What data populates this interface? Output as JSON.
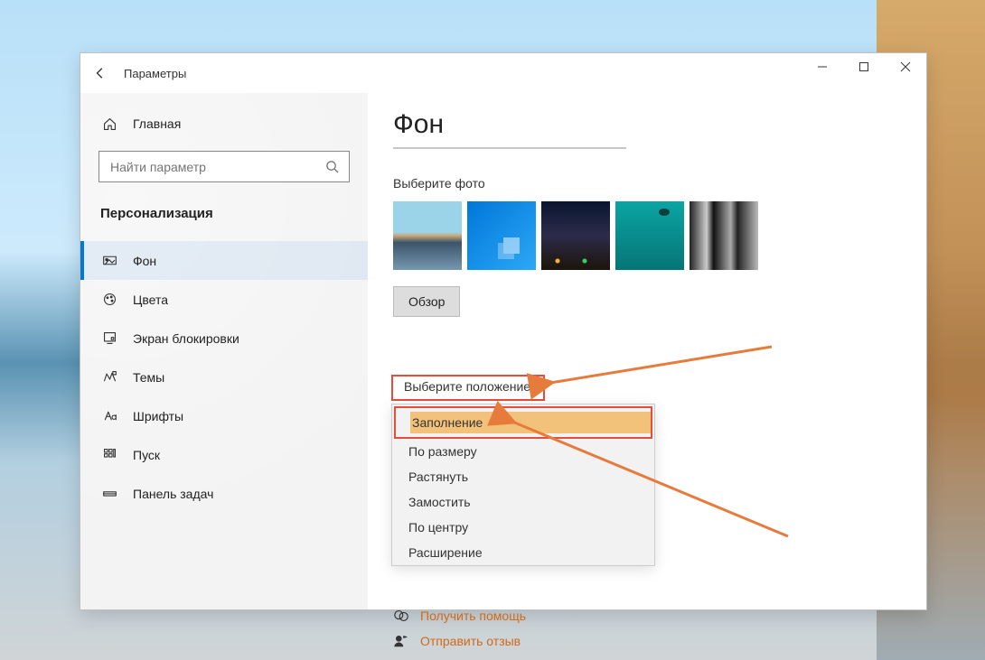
{
  "window": {
    "title": "Параметры"
  },
  "sidebar": {
    "home": "Главная",
    "search_placeholder": "Найти параметр",
    "category": "Персонализация",
    "items": [
      {
        "label": "Фон",
        "selected": true
      },
      {
        "label": "Цвета"
      },
      {
        "label": "Экран блокировки"
      },
      {
        "label": "Темы"
      },
      {
        "label": "Шрифты"
      },
      {
        "label": "Пуск"
      },
      {
        "label": "Панель задач"
      }
    ]
  },
  "page": {
    "title": "Фон",
    "choose_photo_label": "Выберите фото",
    "browse": "Обзор",
    "fit_label": "Выберите положение",
    "fit_options": [
      "Заполнение",
      "По размеру",
      "Растянуть",
      "Замостить",
      "По центру",
      "Расширение"
    ],
    "help": "Получить помощь",
    "feedback": "Отправить отзыв"
  }
}
